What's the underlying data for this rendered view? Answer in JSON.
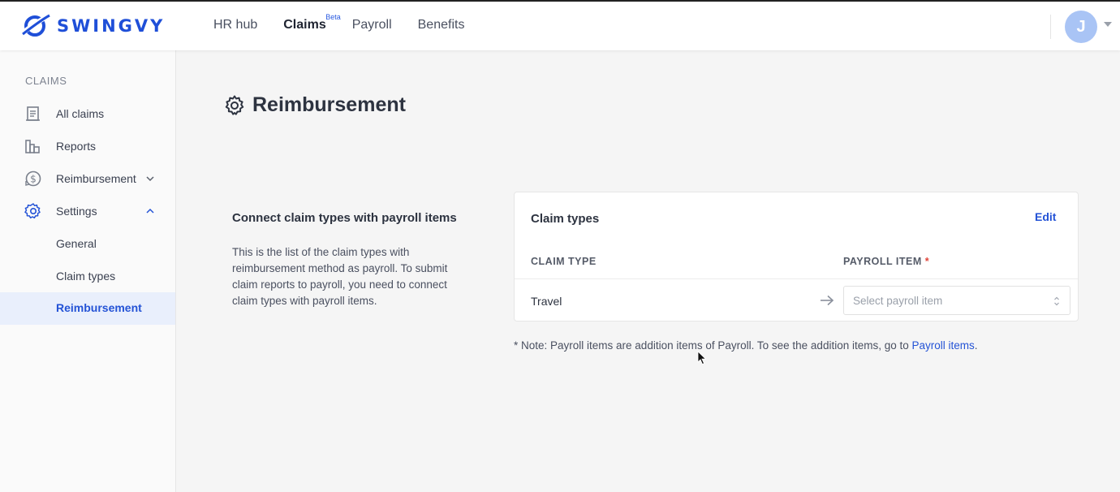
{
  "brand": {
    "name": "SWINGVY",
    "color": "#1f4fd8"
  },
  "nav": {
    "items": [
      {
        "label": "HR hub"
      },
      {
        "label": "Claims",
        "badge": "Beta"
      },
      {
        "label": "Payroll"
      },
      {
        "label": "Benefits"
      }
    ]
  },
  "user": {
    "initial": "J"
  },
  "sidebar": {
    "heading": "CLAIMS",
    "items": [
      {
        "label": "All claims",
        "icon": "document-icon"
      },
      {
        "label": "Reports",
        "icon": "bar-chart-icon"
      },
      {
        "label": "Reimbursement",
        "icon": "dollar-cycle-icon"
      },
      {
        "label": "Settings",
        "icon": "gear-icon"
      }
    ],
    "sub_items": [
      {
        "label": "General"
      },
      {
        "label": "Claim types"
      },
      {
        "label": "Reimbursement"
      }
    ]
  },
  "page": {
    "title": "Reimbursement"
  },
  "section": {
    "title": "Connect claim types with payroll items",
    "description": "This is the list of the claim types with reimbursement method as payroll. To submit claim reports to payroll, you need to connect claim types with payroll items."
  },
  "card": {
    "title": "Claim types",
    "edit_label": "Edit",
    "col_claim_type": "CLAIM TYPE",
    "col_payroll_item": "PAYROLL ITEM",
    "required_mark": "*",
    "rows": [
      {
        "claim_type": "Travel",
        "payroll_placeholder": "Select payroll item"
      }
    ]
  },
  "note": {
    "text": "* Note: Payroll items are addition items of Payroll. To see the addition items, go to ",
    "link": "Payroll items",
    "suffix": "."
  }
}
